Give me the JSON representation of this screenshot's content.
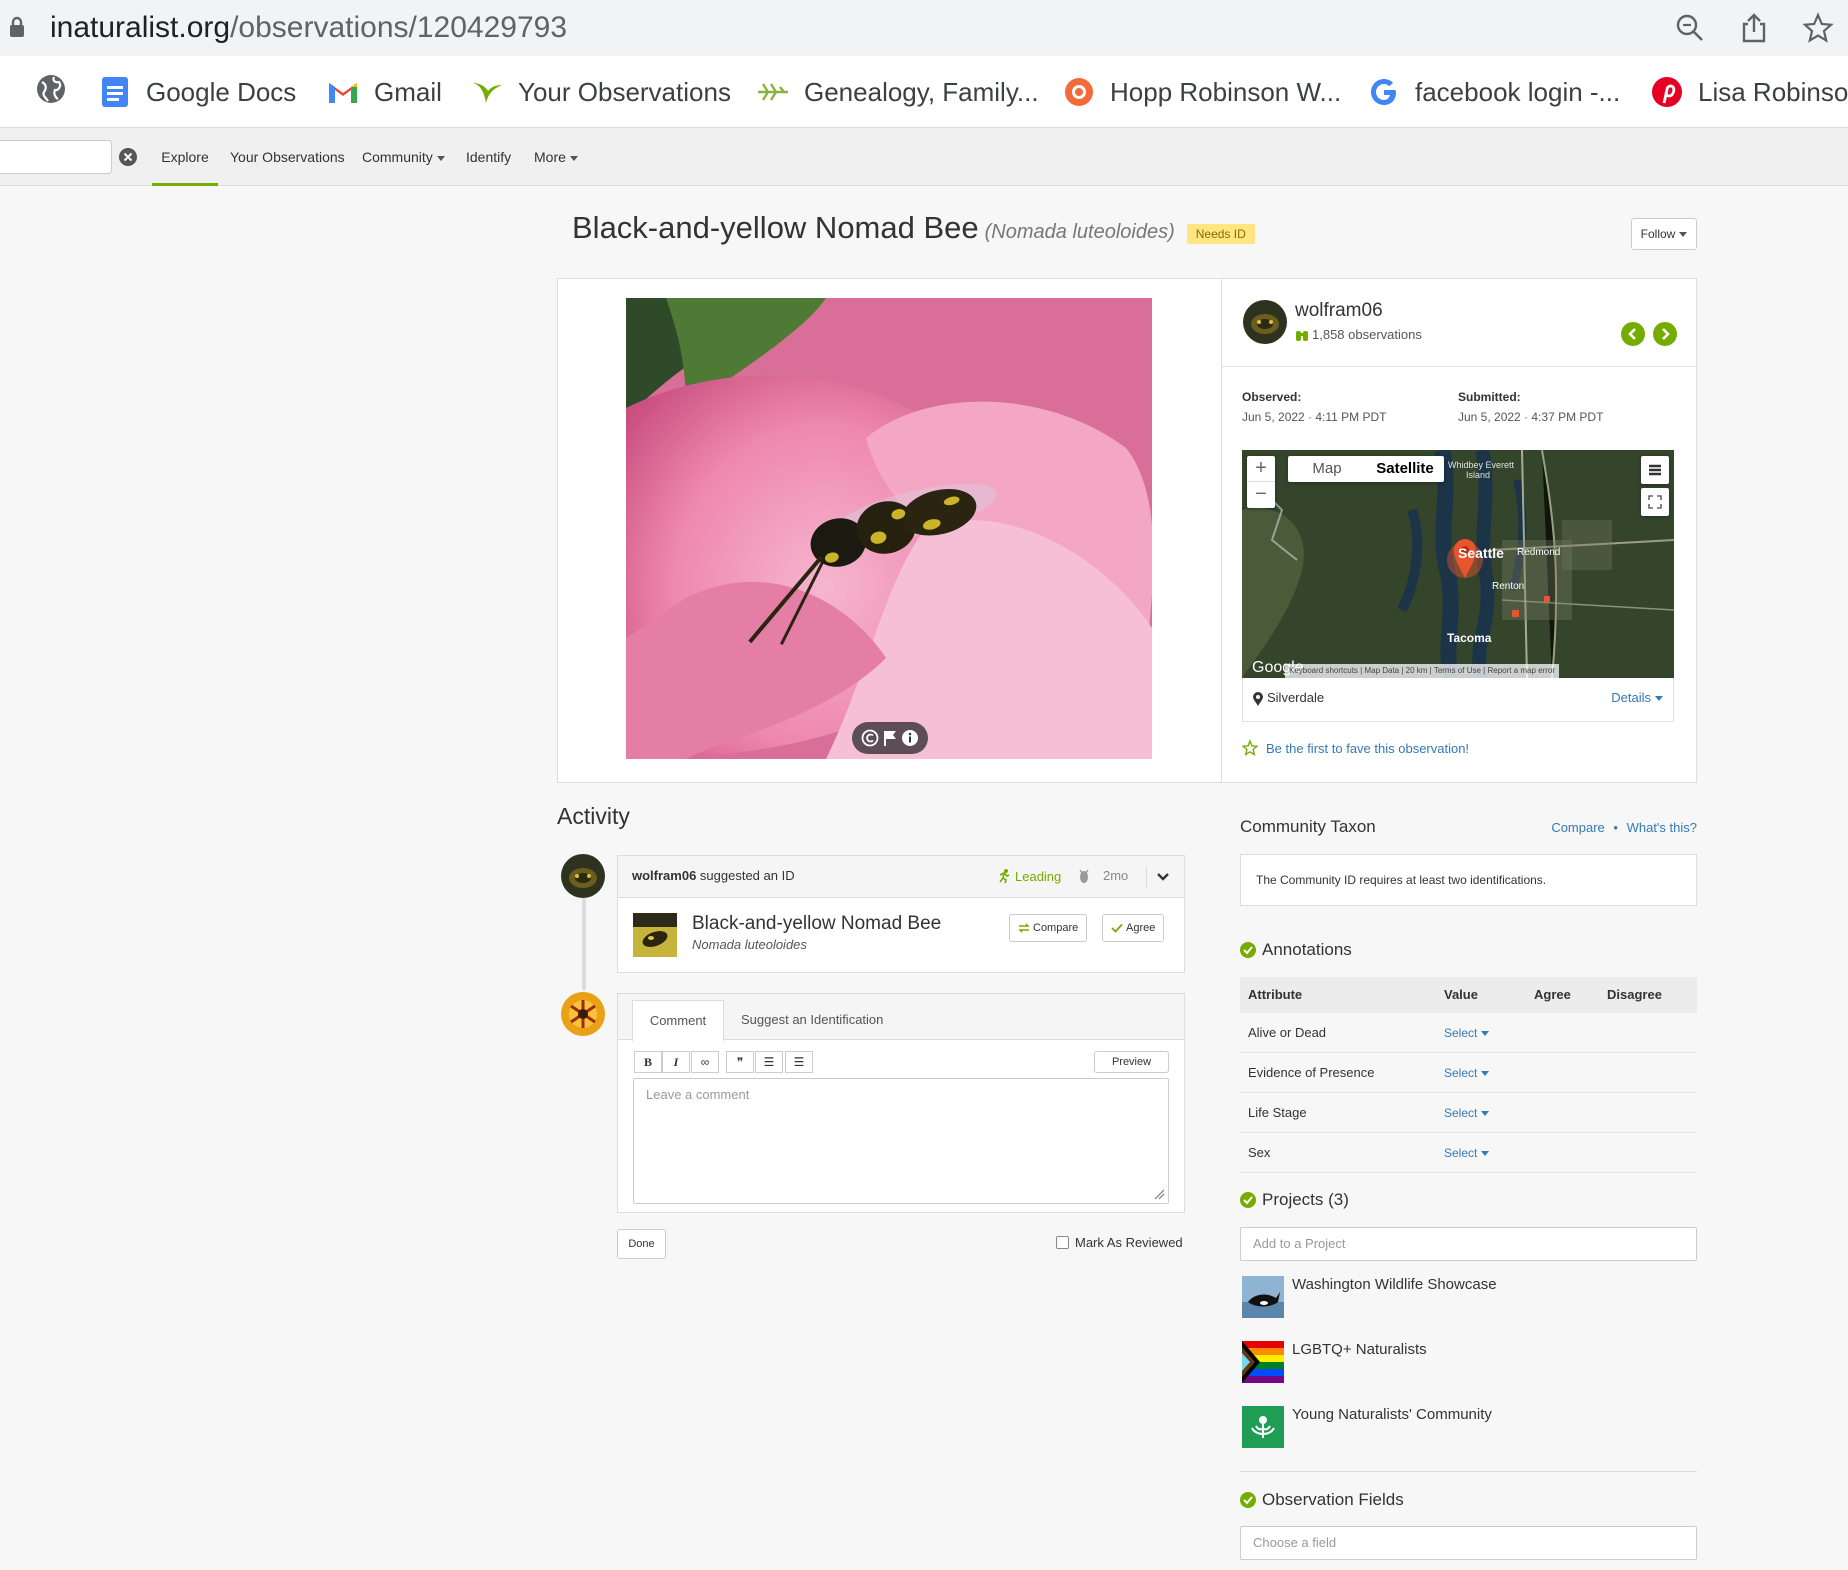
{
  "browser": {
    "url_domain": "inaturalist.org",
    "url_path": "/observations/120429793",
    "bookmarks": [
      {
        "label": "Google Docs"
      },
      {
        "label": "Gmail"
      },
      {
        "label": "Your Observations"
      },
      {
        "label": "Genealogy, Family..."
      },
      {
        "label": "Hopp Robinson W..."
      },
      {
        "label": "facebook login -..."
      },
      {
        "label": "Lisa Robinson"
      }
    ]
  },
  "nav": {
    "explore": "Explore",
    "your_observations": "Your Observations",
    "community": "Community",
    "identify": "Identify",
    "more": "More"
  },
  "observation": {
    "common_name": "Black-and-yellow Nomad Bee",
    "scientific_name": "(Nomada luteoloides)",
    "quality_badge": "Needs ID",
    "follow_label": "Follow",
    "user": "wolfram06",
    "obs_count": "1,858 observations",
    "observed_label": "Observed:",
    "observed_value": "Jun 5, 2022 · 4:11 PM PDT",
    "submitted_label": "Submitted:",
    "submitted_value": "Jun 5, 2022 · 4:37 PM PDT",
    "place": "Silverdale",
    "details_label": "Details",
    "fave_text": "Be the first to fave this observation!"
  },
  "map": {
    "map_tab": "Map",
    "satellite_tab": "Satellite",
    "zoom_in": "+",
    "zoom_out": "−",
    "labels": {
      "whidbey": "Whidbey Everett",
      "island": "Island",
      "seattle": "Seattle",
      "redmond": "Redmond",
      "renton": "Renton",
      "tacoma": "Tacoma",
      "google": "Google"
    },
    "attribution": "Keyboard shortcuts | Map Data | 20 km | Terms of Use | Report a map error"
  },
  "activity": {
    "heading": "Activity",
    "id_user": "wolfram06",
    "id_action": " suggested an ID",
    "leading": "Leading",
    "age": "2mo",
    "taxon_common": "Black-and-yellow Nomad Bee",
    "taxon_sci": "Nomada luteoloides",
    "compare_btn": "Compare",
    "agree_btn": "Agree",
    "tab_comment": "Comment",
    "tab_suggest": "Suggest an Identification",
    "preview_btn": "Preview",
    "comment_placeholder": "Leave a comment",
    "done_btn": "Done",
    "mark_reviewed": "Mark As Reviewed",
    "toolbar": {
      "bold": "B",
      "italic": "I",
      "link": "∞",
      "quote": "❞",
      "ul": "☰",
      "ol": "☰"
    }
  },
  "community_taxon": {
    "heading": "Community Taxon",
    "compare_link": "Compare",
    "whats_this_link": "What's this?",
    "sep": "•",
    "message": "The Community ID requires at least two identifications."
  },
  "annotations": {
    "heading": "Annotations",
    "columns": [
      "Attribute",
      "Value",
      "Agree",
      "Disagree"
    ],
    "rows": [
      {
        "attribute": "Alive or Dead",
        "value": "Select"
      },
      {
        "attribute": "Evidence of Presence",
        "value": "Select"
      },
      {
        "attribute": "Life Stage",
        "value": "Select"
      },
      {
        "attribute": "Sex",
        "value": "Select"
      }
    ]
  },
  "projects": {
    "heading": "Projects (3)",
    "add_placeholder": "Add to a Project",
    "items": [
      {
        "name": "Washington Wildlife Showcase"
      },
      {
        "name": "LGBTQ+ Naturalists"
      },
      {
        "name": "Young Naturalists' Community"
      }
    ]
  },
  "observation_fields": {
    "heading": "Observation Fields",
    "placeholder": "Choose a field"
  },
  "colors": {
    "accent_green": "#74ac00",
    "link_blue": "#337ab7",
    "needs_id_bg": "#ffe680"
  }
}
